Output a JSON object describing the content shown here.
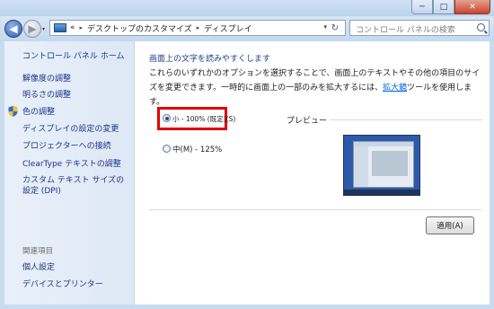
{
  "window": {
    "minimize": "─",
    "maximize": "□",
    "close": "✕"
  },
  "nav": {
    "back": "◀",
    "forward": "▶",
    "history": "▾",
    "breadcrumb": [
      "«",
      "デスクトップのカスタマイズ",
      "ディスプレイ"
    ],
    "address_dropdown": "▾",
    "refresh": "↻"
  },
  "search": {
    "placeholder": "コントロール パネルの検索"
  },
  "sidebar": {
    "home": "コントロール パネル ホーム",
    "items": [
      {
        "label": "解像度の調整"
      },
      {
        "label": "明るさの調整"
      },
      {
        "label": "色の調整"
      },
      {
        "label": "ディスプレイの設定の変更"
      },
      {
        "label": "プロジェクターへの接続"
      },
      {
        "label": "ClearType テキストの調整"
      },
      {
        "label": "カスタム テキスト サイズの設定 (DPI)"
      }
    ],
    "related_heading": "関連項目",
    "related": [
      {
        "label": "個人設定"
      },
      {
        "label": "デバイスとプリンター"
      }
    ]
  },
  "main": {
    "title": "画面上の文字を読みやすくします",
    "description_pre": "これらのいずれかのオプションを選択することで、画面上のテキストやその他の項目のサイズを変更できます。一時的に画面上の一部のみを拡大するには、",
    "description_link": "拡大鏡",
    "description_post": "ツールを使用します。",
    "options": [
      {
        "label": "小 - 100% (既定)(S)",
        "selected": true
      },
      {
        "label": "中(M) - 125%",
        "selected": false
      }
    ],
    "preview_label": "プレビュー",
    "apply_button": "適用(A)"
  },
  "colors": {
    "highlight": "#e00000",
    "link": "#0066cc",
    "sidebar_link": "#1e3287"
  }
}
